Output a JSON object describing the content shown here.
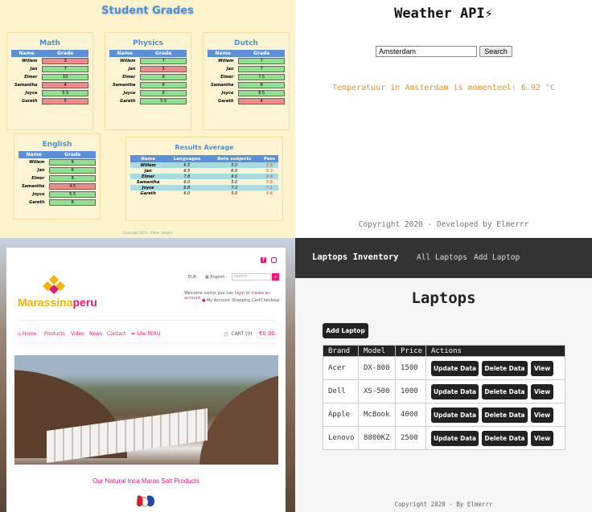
{
  "grades": {
    "title": "Student Grades",
    "name_header": "Name",
    "grade_header": "Grade",
    "subjects": [
      {
        "name": "Math",
        "rows": [
          [
            "Willem",
            "3"
          ],
          [
            "Jan",
            "7"
          ],
          [
            "Elmer",
            "10"
          ],
          [
            "Samantha",
            "4"
          ],
          [
            "Joyce",
            "5.5"
          ],
          [
            "Gareth",
            "5"
          ]
        ]
      },
      {
        "name": "Physics",
        "rows": [
          [
            "Willem",
            "7"
          ],
          [
            "Jan",
            "5"
          ],
          [
            "Elmer",
            "8"
          ],
          [
            "Samantha",
            "6"
          ],
          [
            "Joyce",
            "6"
          ],
          [
            "Gareth",
            "5.5"
          ]
        ]
      },
      {
        "name": "Dutch",
        "rows": [
          [
            "Willem",
            "7"
          ],
          [
            "Jan",
            "7"
          ],
          [
            "Elmer",
            "7.5"
          ],
          [
            "Samantha",
            "8"
          ],
          [
            "Joyce",
            "8.5"
          ],
          [
            "Gareth",
            "4"
          ]
        ]
      },
      {
        "name": "English",
        "rows": [
          [
            "Willem",
            "6"
          ],
          [
            "Jan",
            "6"
          ],
          [
            "Elmer",
            "8"
          ],
          [
            "Samantha",
            "4.5"
          ],
          [
            "Joyce",
            "5.5"
          ],
          [
            "Gareth",
            "8"
          ]
        ]
      }
    ],
    "average": {
      "title": "Results Average",
      "headers": [
        "Name",
        "Languages",
        "Beta subjects",
        "Pass"
      ],
      "rows": [
        [
          "Willem",
          "6.5",
          "5.0",
          "5.8"
        ],
        [
          "Jan",
          "6.5",
          "6.0",
          "6.3"
        ],
        [
          "Elmer",
          "7.8",
          "9.0",
          "8.4"
        ],
        [
          "Samantha",
          "6.0",
          "5.0",
          "5.6"
        ],
        [
          "Joyce",
          "6.8",
          "7.3",
          "7.1"
        ],
        [
          "Gareth",
          "6.0",
          "5.0",
          "5.6"
        ]
      ]
    },
    "footer": "Copyright 2020 - Elmer Volgers"
  },
  "weather": {
    "title": "Weather API⚡",
    "input_value": "Amsterdam",
    "button": "Search",
    "message": "Temperatuur in Amsterdam is momenteel: 6.92 °C",
    "footer": "Copyright 2020 - Developed by Elmerrr"
  },
  "shop": {
    "logo_a": "Marassina",
    "logo_b": "peru",
    "currency": "EUR -",
    "language": "English -",
    "search_placeholder": "search",
    "welcome_a": "Welcome visitor you can",
    "welcome_login": "login",
    "welcome_or": "or",
    "welcome_create": "create an account.",
    "my_account": "My Account",
    "shopping_cart": "Shopping Cart",
    "checkout": "Checkout",
    "nav": [
      "Home",
      "Products",
      "Video",
      "News",
      "Contact",
      "Site PERU"
    ],
    "cart": "CART (0)",
    "price": "€0.00",
    "caption": "Our Natural Inca Maras Salt Products"
  },
  "laptops": {
    "brand": "Laptops Inventory",
    "nav": [
      "All Laptops",
      "Add Laptop"
    ],
    "heading": "Laptops",
    "add_button": "Add Laptop",
    "headers": [
      "Brand",
      "Model",
      "Price",
      "Actions"
    ],
    "rows": [
      [
        "Acer",
        "DX-800",
        "1500"
      ],
      [
        "Dell",
        "XS-500",
        "1000"
      ],
      [
        "Apple",
        "McBook",
        "4000"
      ],
      [
        "Lenovo",
        "8800KZ",
        "2500"
      ]
    ],
    "actions": [
      "Update Data",
      "Delete Data",
      "View"
    ],
    "footer": "Copyright 2020 - By Elmerrr"
  }
}
